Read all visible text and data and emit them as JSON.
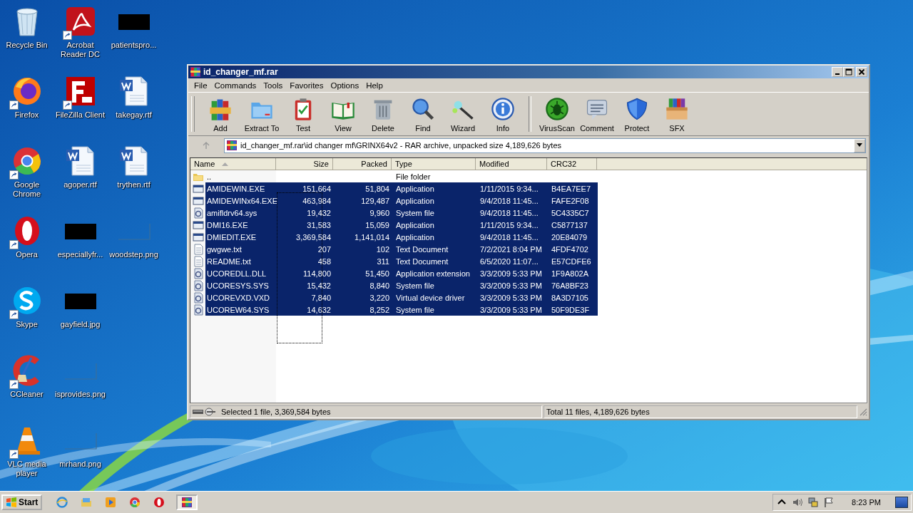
{
  "desktop": {
    "columns": [
      {
        "icons": [
          {
            "label": "Recycle Bin",
            "kind": "recycle",
            "shortcut": false
          },
          {
            "label": "Firefox",
            "kind": "firefox",
            "shortcut": true
          },
          {
            "label": "Google Chrome",
            "kind": "chrome",
            "shortcut": true
          },
          {
            "label": "Opera",
            "kind": "opera",
            "shortcut": true
          },
          {
            "label": "Skype",
            "kind": "skype",
            "shortcut": true
          },
          {
            "label": "CCleaner",
            "kind": "ccleaner",
            "shortcut": true
          },
          {
            "label": "VLC media player",
            "kind": "vlc",
            "shortcut": true
          }
        ]
      },
      {
        "icons": [
          {
            "label": "Acrobat Reader DC",
            "kind": "pdf",
            "shortcut": true
          },
          {
            "label": "FileZilla Client",
            "kind": "filezilla",
            "shortcut": true
          },
          {
            "label": "agoper.rtf",
            "kind": "word",
            "shortcut": false
          },
          {
            "label": "especiallyfr...",
            "kind": "dark-thumb",
            "shortcut": false
          },
          {
            "label": "gayfield.jpg",
            "kind": "dark-thumb",
            "shortcut": false
          },
          {
            "label": "isprovides.png",
            "kind": "blank-thumb",
            "shortcut": false
          },
          {
            "label": "mrhand.png",
            "kind": "blank-thumb",
            "shortcut": false
          }
        ]
      },
      {
        "icons": [
          {
            "label": "patientspro...",
            "kind": "dark-thumb",
            "shortcut": false
          },
          {
            "label": "takegay.rtf",
            "kind": "word",
            "shortcut": false
          },
          {
            "label": "trythen.rtf",
            "kind": "word",
            "shortcut": false
          },
          {
            "label": "woodstep.png",
            "kind": "blank-thumb",
            "shortcut": false
          }
        ]
      }
    ]
  },
  "window": {
    "title": "id_changer_mf.rar",
    "menu": [
      "File",
      "Commands",
      "Tools",
      "Favorites",
      "Options",
      "Help"
    ],
    "toolbar_groups": [
      [
        {
          "label": "Add",
          "kind": "add"
        },
        {
          "label": "Extract To",
          "kind": "extract"
        },
        {
          "label": "Test",
          "kind": "test"
        },
        {
          "label": "View",
          "kind": "view"
        },
        {
          "label": "Delete",
          "kind": "delete"
        },
        {
          "label": "Find",
          "kind": "find"
        },
        {
          "label": "Wizard",
          "kind": "wizard"
        },
        {
          "label": "Info",
          "kind": "info"
        }
      ],
      [
        {
          "label": "VirusScan",
          "kind": "virus"
        },
        {
          "label": "Comment",
          "kind": "comment"
        },
        {
          "label": "Protect",
          "kind": "protect"
        },
        {
          "label": "SFX",
          "kind": "sfx"
        }
      ]
    ],
    "address": "id_changer_mf.rar\\id changer mf\\GRINX64v2 - RAR archive, unpacked size 4,189,626 bytes",
    "columns": [
      {
        "label": "Name",
        "kind": "text",
        "sorted": true
      },
      {
        "label": "Size",
        "kind": "number",
        "sorted": false
      },
      {
        "label": "Packed",
        "kind": "number",
        "sorted": false
      },
      {
        "label": "Type",
        "kind": "text",
        "sorted": false
      },
      {
        "label": "Modified",
        "kind": "text",
        "sorted": false
      },
      {
        "label": "CRC32",
        "kind": "text",
        "sorted": false
      }
    ],
    "rows": [
      {
        "kind": "folder",
        "selected": false,
        "cells": [
          "..",
          "",
          "",
          "File folder",
          "",
          ""
        ]
      },
      {
        "kind": "app",
        "selected": true,
        "cells": [
          "AMIDEWIN.EXE",
          "151,664",
          "51,804",
          "Application",
          "1/11/2015 9:34...",
          "B4EA7EE7"
        ]
      },
      {
        "kind": "app",
        "selected": true,
        "cells": [
          "AMIDEWINx64.EXE",
          "463,984",
          "129,487",
          "Application",
          "9/4/2018 11:45...",
          "FAFE2F08"
        ]
      },
      {
        "kind": "driver",
        "selected": true,
        "cells": [
          "amifldrv64.sys",
          "19,432",
          "9,960",
          "System file",
          "9/4/2018 11:45...",
          "5C4335C7"
        ]
      },
      {
        "kind": "app",
        "selected": true,
        "cells": [
          "DMI16.EXE",
          "31,583",
          "15,059",
          "Application",
          "1/11/2015 9:34...",
          "C5877137"
        ]
      },
      {
        "kind": "app",
        "selected": true,
        "cells": [
          "DMIEDIT.EXE",
          "3,369,584",
          "1,141,014",
          "Application",
          "9/4/2018 11:45...",
          "20E84079"
        ]
      },
      {
        "kind": "text",
        "selected": true,
        "cells": [
          "gwgwe.txt",
          "207",
          "102",
          "Text Document",
          "7/2/2021 8:04 PM",
          "4FDF4702"
        ]
      },
      {
        "kind": "text",
        "selected": true,
        "cells": [
          "README.txt",
          "458",
          "311",
          "Text Document",
          "6/5/2020 11:07...",
          "E57CDFE6"
        ]
      },
      {
        "kind": "driver",
        "selected": true,
        "cells": [
          "UCOREDLL.DLL",
          "114,800",
          "51,450",
          "Application extension",
          "3/3/2009 5:33 PM",
          "1F9A802A"
        ]
      },
      {
        "kind": "driver",
        "selected": true,
        "cells": [
          "UCORESYS.SYS",
          "15,432",
          "8,840",
          "System file",
          "3/3/2009 5:33 PM",
          "76A8BF23"
        ]
      },
      {
        "kind": "driver",
        "selected": true,
        "cells": [
          "UCOREVXD.VXD",
          "7,840",
          "3,220",
          "Virtual device driver",
          "3/3/2009 5:33 PM",
          "8A3D7105"
        ]
      },
      {
        "kind": "driver",
        "selected": true,
        "cells": [
          "UCOREW64.SYS",
          "14,632",
          "8,252",
          "System file",
          "3/3/2009 5:33 PM",
          "50F9DE3F"
        ]
      }
    ],
    "status_bar": {
      "selection": "Selected 1 file, 3,369,584 bytes",
      "total": "Total 11 files, 4,189,626 bytes"
    }
  },
  "taskbar": {
    "start": "Start",
    "apps": [
      {
        "kind": "ie",
        "active": false
      },
      {
        "kind": "explorer",
        "active": false
      },
      {
        "kind": "media",
        "active": false
      },
      {
        "kind": "chrome",
        "active": false
      },
      {
        "kind": "opera",
        "active": false
      },
      {
        "kind": "winrar",
        "active": true
      }
    ],
    "tray": [
      {
        "kind": "caret"
      },
      {
        "kind": "speaker"
      },
      {
        "kind": "network"
      },
      {
        "kind": "flag"
      }
    ],
    "clock": "8:23 PM"
  }
}
